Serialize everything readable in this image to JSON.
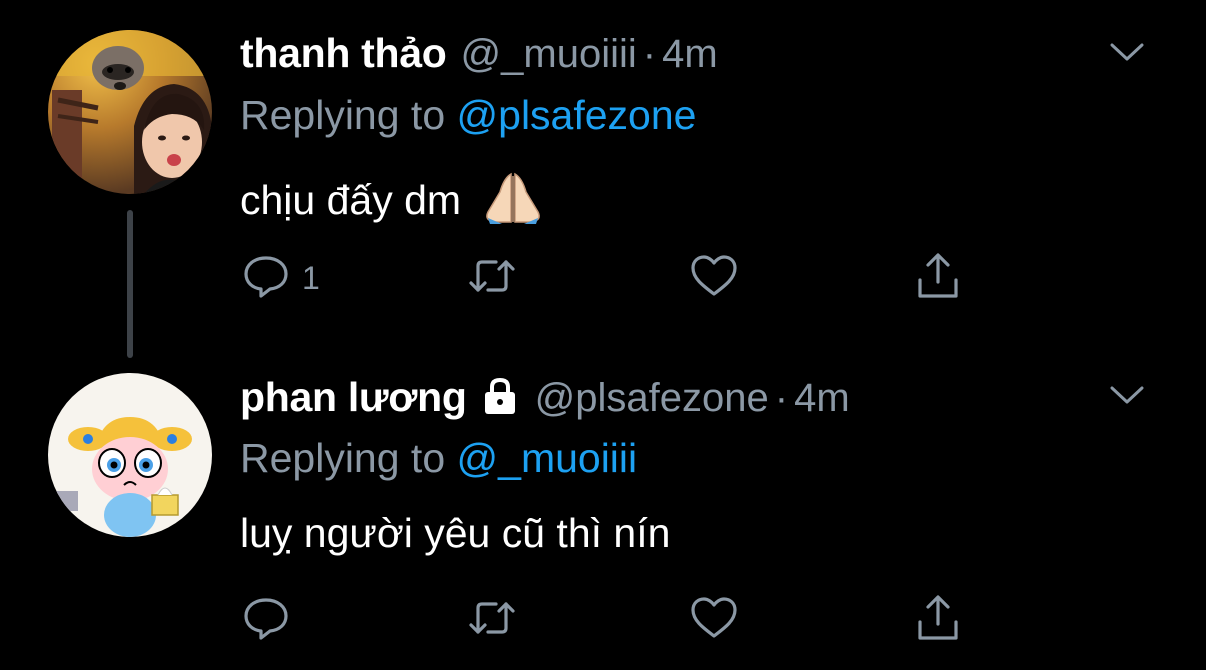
{
  "colors": {
    "background": "#000000",
    "text": "#ffffff",
    "secondary": "#8b98a5",
    "link": "#1da1f2",
    "thread_line": "#3d4248"
  },
  "tweets": [
    {
      "display_name": "thanh thảo",
      "handle": "@_muoiiii",
      "separator": "·",
      "time": "4m",
      "replying_prefix": "Replying to ",
      "replying_to": "@plsafezone",
      "text": "chịu đấy dm",
      "emoji": "folded-hands",
      "reply_count": "1",
      "icons": [
        "reply-icon",
        "retweet-icon",
        "like-icon",
        "share-icon"
      ]
    },
    {
      "display_name": "phan lương",
      "protected": true,
      "handle": "@plsafezone",
      "separator": "·",
      "time": "4m",
      "replying_prefix": "Replying to ",
      "replying_to": "@_muoiiii",
      "text": "luỵ người yêu cũ thì nín",
      "reply_count": "",
      "icons": [
        "reply-icon",
        "retweet-icon",
        "like-icon",
        "share-icon"
      ]
    }
  ]
}
